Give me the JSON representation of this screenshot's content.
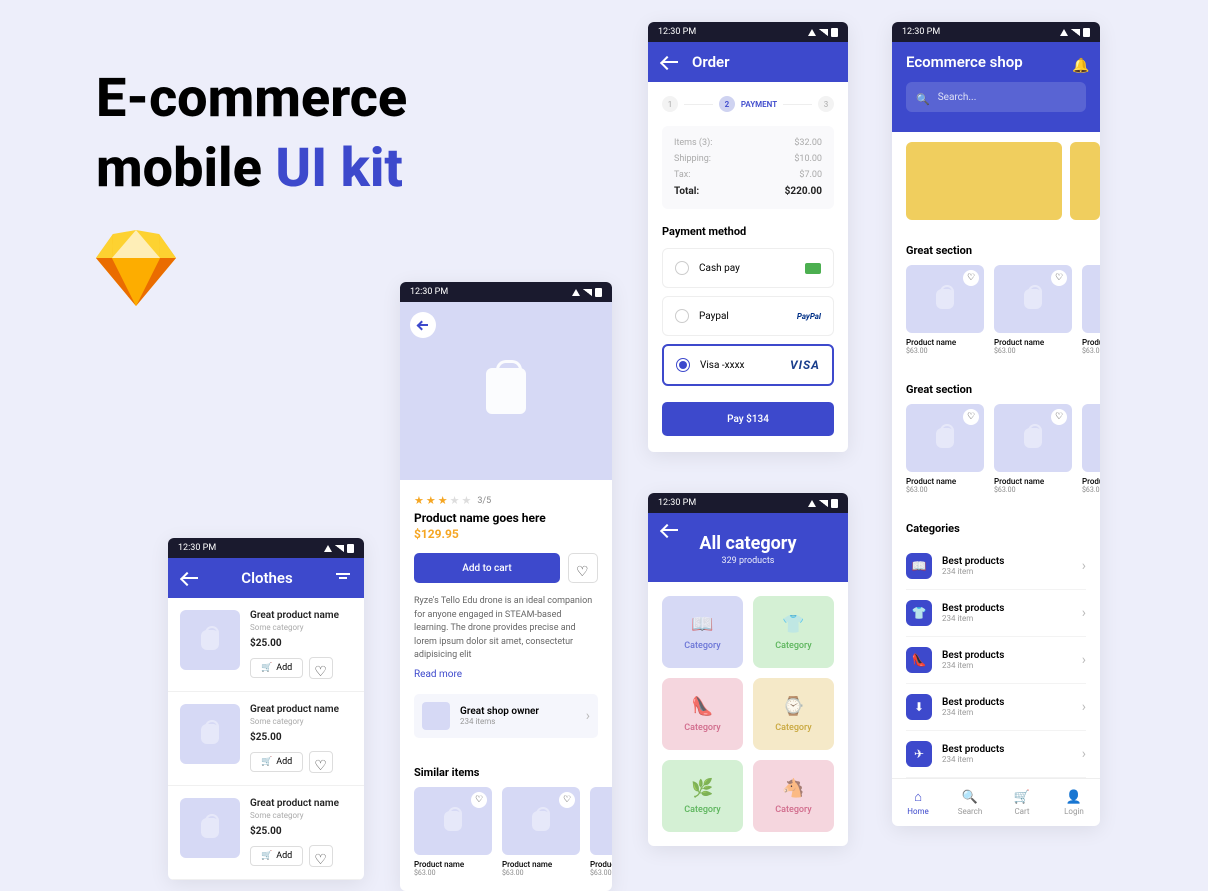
{
  "title_line1": "E-commerce",
  "title_line2a": "mobile ",
  "title_line2b": "UI kit",
  "time": "12:30 PM",
  "clothes": {
    "title": "Clothes",
    "items": [
      {
        "name": "Great product name",
        "cat": "Some category",
        "price": "$25.00",
        "add": "Add"
      },
      {
        "name": "Great product name",
        "cat": "Some category",
        "price": "$25.00",
        "add": "Add"
      },
      {
        "name": "Great product name",
        "cat": "Some category",
        "price": "$25.00",
        "add": "Add"
      }
    ]
  },
  "detail": {
    "rating_text": "3/5",
    "name": "Product name goes here",
    "price": "$129.95",
    "add_to_cart": "Add to cart",
    "desc": "Ryze's Tello Edu drone is an ideal companion for anyone engaged in STEAM-based learning. The drone provides precise and lorem ipsum dolor sit amet, consectetur adipisicing elit",
    "read_more": "Read more",
    "shop_name": "Great shop owner",
    "shop_count": "234 items",
    "similar": "Similar items",
    "items": [
      {
        "name": "Product name",
        "price": "$63.00"
      },
      {
        "name": "Product name",
        "price": "$63.00"
      },
      {
        "name": "Product name",
        "price": "$63.00"
      }
    ]
  },
  "order": {
    "title": "Order",
    "step1": "1",
    "step2": "2",
    "step2_label": "PAYMENT",
    "step3": "3",
    "items_label": "Items (3):",
    "items_val": "$32.00",
    "ship_label": "Shipping:",
    "ship_val": "$10.00",
    "tax_label": "Tax:",
    "tax_val": "$7.00",
    "total_label": "Total:",
    "total_val": "$220.00",
    "pay_method": "Payment method",
    "cash": "Cash pay",
    "paypal": "Paypal",
    "visa": "Visa -xxxx",
    "visa_logo": "VISA",
    "paypal_logo": "PayPal",
    "pay_btn": "Pay $134"
  },
  "categories": {
    "title": "All category",
    "sub": "329 products",
    "tiles": [
      {
        "label": "Category",
        "ic": "📖",
        "cls": "c-blue"
      },
      {
        "label": "Category",
        "ic": "👕",
        "cls": "c-green"
      },
      {
        "label": "Category",
        "ic": "👠",
        "cls": "c-pink"
      },
      {
        "label": "Category",
        "ic": "⌚",
        "cls": "c-yellow"
      },
      {
        "label": "Category",
        "ic": "🌿",
        "cls": "c-green"
      },
      {
        "label": "Category",
        "ic": "🐴",
        "cls": "c-pink"
      }
    ]
  },
  "home": {
    "title": "Ecommerce shop",
    "search_ph": "Search...",
    "section": "Great section",
    "prod_name": "Product name",
    "prod_price": "$63.00",
    "prod_name_cut": "Product n",
    "cats_h": "Categories",
    "cats": [
      {
        "name": "Best products",
        "count": "234 item",
        "ic": "📖"
      },
      {
        "name": "Best products",
        "count": "234 item",
        "ic": "👕"
      },
      {
        "name": "Best products",
        "count": "234 item",
        "ic": "👠"
      },
      {
        "name": "Best products",
        "count": "234 item",
        "ic": "⬇"
      },
      {
        "name": "Best products",
        "count": "234 item",
        "ic": "✈"
      }
    ],
    "tabs": [
      {
        "label": "Home",
        "ic": "⌂"
      },
      {
        "label": "Search",
        "ic": "🔍"
      },
      {
        "label": "Cart",
        "ic": "🛒"
      },
      {
        "label": "Login",
        "ic": "👤"
      }
    ]
  }
}
